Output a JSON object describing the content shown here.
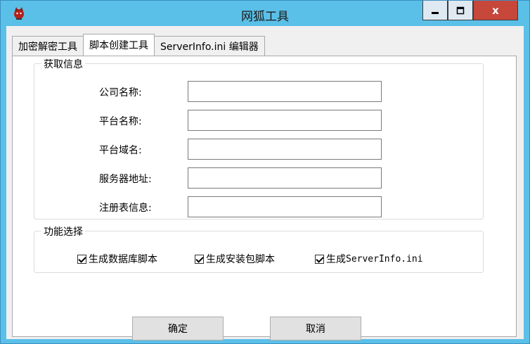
{
  "window": {
    "title": "网狐工具",
    "close_glyph": "x"
  },
  "tabs": [
    {
      "label": "加密解密工具"
    },
    {
      "label": "脚本创建工具"
    },
    {
      "label": "ServerInfo.ini 编辑器"
    }
  ],
  "info_group": {
    "title": "获取信息",
    "fields": [
      {
        "label": "公司名称:",
        "value": ""
      },
      {
        "label": "平台名称:",
        "value": ""
      },
      {
        "label": "平台域名:",
        "value": ""
      },
      {
        "label": "服务器地址:",
        "value": ""
      },
      {
        "label": "注册表信息:",
        "value": ""
      }
    ]
  },
  "function_group": {
    "title": "功能选择",
    "options": [
      {
        "label": "生成数据库脚本",
        "checked": true
      },
      {
        "label": "生成安装包脚本",
        "checked": true
      },
      {
        "label_prefix": "生成",
        "label_suffix": "ServerInfo.ini",
        "checked": true
      }
    ]
  },
  "buttons": {
    "ok": "确定",
    "cancel": "取消"
  },
  "colors": {
    "titlebar": "#5bc0e8",
    "close_button": "#c7473a"
  },
  "icons": {
    "app": "fox-icon"
  }
}
